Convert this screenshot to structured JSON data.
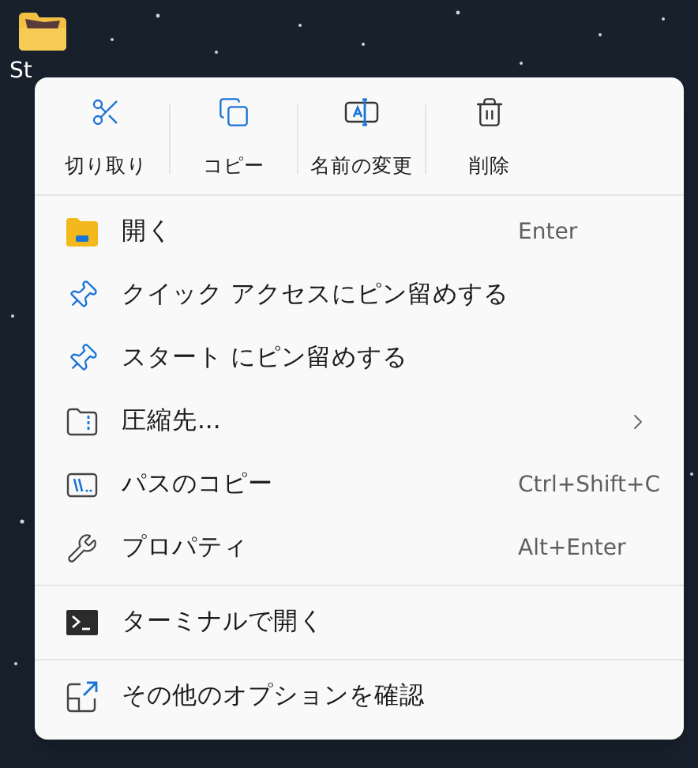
{
  "desktop": {
    "icon_label": "St"
  },
  "menu": {
    "toolbar": [
      {
        "kind": "cut",
        "label": "切り取り"
      },
      {
        "kind": "copy",
        "label": "コピー"
      },
      {
        "kind": "rename",
        "label": "名前の変更"
      },
      {
        "kind": "delete",
        "label": "削除"
      }
    ],
    "sections": [
      {
        "items": [
          {
            "kind": "open",
            "label": "開く",
            "shortcut": "Enter",
            "submenu": false
          },
          {
            "kind": "pin",
            "label": "クイック アクセスにピン留めする",
            "submenu": false
          },
          {
            "kind": "pin",
            "label": "スタート にピン留めする",
            "submenu": false
          },
          {
            "kind": "zip",
            "label": "圧縮先...",
            "submenu": true
          },
          {
            "kind": "path",
            "label": "パスのコピー",
            "shortcut": "Ctrl+Shift+C",
            "submenu": false
          },
          {
            "kind": "properties",
            "label": "プロパティ",
            "shortcut": "Alt+Enter",
            "submenu": false
          }
        ]
      },
      {
        "items": [
          {
            "kind": "terminal",
            "label": "ターミナルで開く",
            "submenu": false
          }
        ]
      },
      {
        "items": [
          {
            "kind": "more",
            "label": "その他のオプションを確認",
            "submenu": false
          }
        ]
      }
    ]
  }
}
